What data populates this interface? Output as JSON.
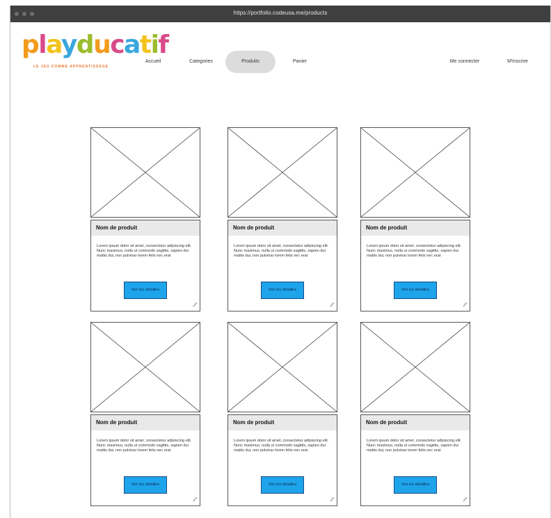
{
  "browser": {
    "url": "https://portfolio.codeusa.me/products"
  },
  "header": {
    "logo_text": "playducatif",
    "logo_colors": [
      "#f39b1d",
      "#d94a8a",
      "#f2c31a",
      "#3aa7dd",
      "#9bbc2d",
      "#f39b1d",
      "#d94a8a",
      "#3aa7dd",
      "#f2c31a",
      "#9bbc2d",
      "#d94a8a"
    ],
    "tagline": "LE JEU COMME APPRENTISSAGE",
    "nav": [
      {
        "label": "Accueil",
        "active": false
      },
      {
        "label": "Categories",
        "active": false
      },
      {
        "label": "Produits",
        "active": true
      },
      {
        "label": "Panier",
        "active": false
      }
    ],
    "login_label": "Me connecter",
    "signup_label": "M'inscrire"
  },
  "products": [
    {
      "title": "Nom de produit",
      "description": "Lorem ipsum dolor sit amet, consectetur adipiscing elit. Nunc maximus, nulla ut commodo sagittis, sapien dui mattis dui, non pulvinar lorem felis nec erat",
      "button_label": "Voir les détailles"
    },
    {
      "title": "Nom de produit",
      "description": "Lorem ipsum dolor sit amet, consectetur adipiscing elit. Nunc maximus, nulla ut commodo sagittis, sapien dui mattis dui, non pulvinar lorem felis nec erat",
      "button_label": "Voir les détailles"
    },
    {
      "title": "Nom de produit",
      "description": "Lorem ipsum dolor sit amet, consectetur adipiscing elit. Nunc maximus, nulla ut commodo sagittis, sapien dui mattis dui, non pulvinar lorem felis nec erat",
      "button_label": "Voir les détailles"
    },
    {
      "title": "Nom de produit",
      "description": "Lorem ipsum dolor sit amet, consectetur adipiscing elit. Nunc maximus, nulla ut commodo sagittis, sapien dui mattis dui, non pulvinar lorem felis nec erat",
      "button_label": "Voir les détailles"
    },
    {
      "title": "Nom de produit",
      "description": "Lorem ipsum dolor sit amet, consectetur adipiscing elit. Nunc maximus, nulla ut commodo sagittis, sapien dui mattis dui, non pulvinar lorem felis nec erat",
      "button_label": "Voir les détailles"
    },
    {
      "title": "Nom de produit",
      "description": "Lorem ipsum dolor sit amet, consectetur adipiscing elit. Nunc maximus, nulla ut commodo sagittis, sapien dui mattis dui, non pulvinar lorem felis nec erat",
      "button_label": "Voir les détailles"
    }
  ],
  "colors": {
    "button": "#1ea4ea",
    "card_title_bg": "#e9e9e9",
    "active_nav_bg": "#dcdcdc"
  }
}
